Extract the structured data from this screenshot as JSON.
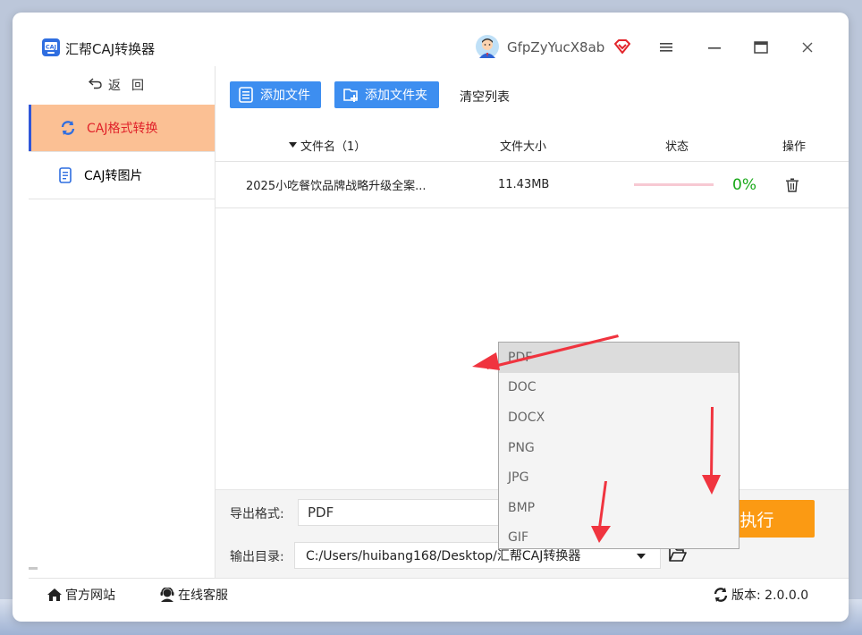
{
  "app": {
    "title": "汇帮CAJ转换器",
    "logo_text": "CAJ"
  },
  "user": {
    "name": "GfpZyYucX8ab"
  },
  "colors": {
    "accent": "#3d8ef0",
    "active_nav_bg": "#fbc094",
    "active_nav_text": "#e0222a",
    "start_button": "#fb9a13",
    "annotation_arrow": "#f0343f",
    "percent_green": "#18a818"
  },
  "sidebar": {
    "back_label": "返回",
    "items": [
      {
        "label": "CAJ格式转换",
        "icon": "refresh-icon",
        "active": true
      },
      {
        "label": "CAJ转图片",
        "icon": "document-icon",
        "active": false
      }
    ]
  },
  "toolbar": {
    "add_file": "添加文件",
    "add_folder": "添加文件夹",
    "clear_list": "清空列表"
  },
  "table": {
    "columns": {
      "name": "文件名（1）",
      "size": "文件大小",
      "status": "状态",
      "action": "操作"
    },
    "rows": [
      {
        "name": "2025小吃餐饮品牌战略升级全案...",
        "size": "11.43MB",
        "progress": 0,
        "percent": "0%"
      }
    ]
  },
  "format_dropdown": {
    "options": [
      "PDF",
      "DOC",
      "DOCX",
      "PNG",
      "JPG",
      "BMP",
      "GIF"
    ],
    "selected": "PDF"
  },
  "export": {
    "format_label": "导出格式:",
    "format_value": "PDF",
    "output_label": "输出目录:",
    "output_path": "C:/Users/huibang168/Desktop/汇帮CAJ转换器",
    "start_label": "开始执行"
  },
  "statusbar": {
    "website": "官方网站",
    "support": "在线客服",
    "version": "版本: 2.0.0.0"
  }
}
